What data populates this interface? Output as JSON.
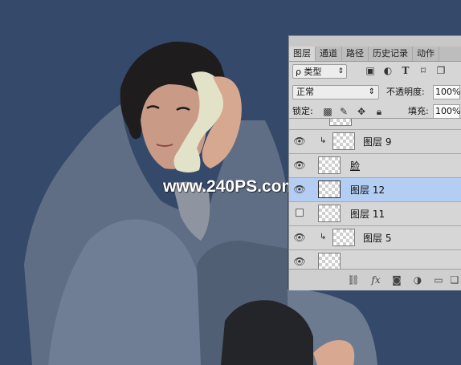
{
  "watermark": "www.240PS.com",
  "panel": {
    "tabs": [
      "图层",
      "通道",
      "路径",
      "历史记录",
      "动作"
    ],
    "filter": {
      "label": "ρ 类型"
    },
    "filter_icons": [
      "image-filter-icon",
      "adjustment-filter-icon",
      "type-filter-icon",
      "shape-filter-icon",
      "smart-object-filter-icon"
    ],
    "blend_mode": "正常",
    "opacity_label": "不透明度:",
    "opacity_value": "100%",
    "lock_label": "锁定:",
    "fill_label": "填充:",
    "fill_value": "100%",
    "layers": [
      {
        "name": "图层 9",
        "visible": true,
        "clipped": true,
        "selected": false
      },
      {
        "name": "脸",
        "visible": true,
        "clipped": false,
        "selected": false
      },
      {
        "name": "图层 12",
        "visible": true,
        "clipped": false,
        "selected": true
      },
      {
        "name": "图层 11",
        "visible": false,
        "clipped": false,
        "selected": false
      },
      {
        "name": "图层 5",
        "visible": true,
        "clipped": true,
        "selected": false
      }
    ],
    "bottom_icons": [
      "link-icon",
      "fx-icon",
      "mask-icon",
      "adjustment-icon",
      "folder-icon",
      "new-layer-icon"
    ]
  }
}
